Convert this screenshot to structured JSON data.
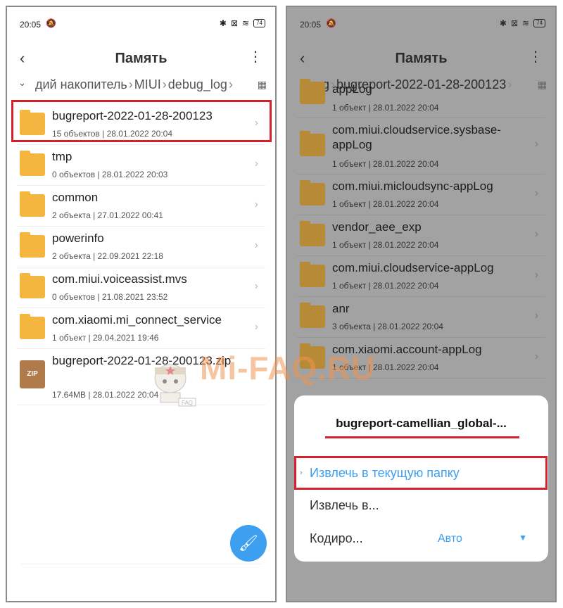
{
  "status": {
    "time": "20:05",
    "battery": "74"
  },
  "left": {
    "title": "Память",
    "breadcrumb": [
      "дий накопитель",
      "MIUI",
      "debug_log"
    ],
    "items": [
      {
        "name": "bugreport-2022-01-28-200123",
        "meta": "15 объектов | 28.01.2022 20:04",
        "type": "folder"
      },
      {
        "name": "tmp",
        "meta": "0 объектов | 28.01.2022 20:03",
        "type": "folder"
      },
      {
        "name": "common",
        "meta": "2 объекта | 27.01.2022 00:41",
        "type": "folder"
      },
      {
        "name": "powerinfo",
        "meta": "2 объекта | 22.09.2021 22:18",
        "type": "folder"
      },
      {
        "name": "com.miui.voiceassist.mvs",
        "meta": "0 объектов | 21.08.2021 23:52",
        "type": "folder"
      },
      {
        "name": "com.xiaomi.mi_connect_service",
        "meta": "1 объект | 29.04.2021 19:46",
        "type": "folder"
      },
      {
        "name": "bugreport-2022-01-28-200123.zip",
        "meta": "17.64MB | 28.01.2022 20:04",
        "type": "zip",
        "icon_text": "ZIP"
      }
    ]
  },
  "right": {
    "title": "Память",
    "breadcrumb": [
      "og",
      "bugreport-2022-01-28-200123"
    ],
    "items": [
      {
        "name": "appLog",
        "meta": "1 объект | 28.01.2022 20:04"
      },
      {
        "name": "com.miui.cloudservice.sysbase-appLog",
        "meta": "1 объект | 28.01.2022 20:04"
      },
      {
        "name": "com.miui.micloudsync-appLog",
        "meta": "1 объект | 28.01.2022 20:04"
      },
      {
        "name": "vendor_aee_exp",
        "meta": "1 объект | 28.01.2022 20:04"
      },
      {
        "name": "com.miui.cloudservice-appLog",
        "meta": "1 объект | 28.01.2022 20:04"
      },
      {
        "name": "anr",
        "meta": "3 объекта | 28.01.2022 20:04"
      },
      {
        "name": "com.xiaomi.account-appLog",
        "meta": "1 объект | 28.01.2022 20:04"
      }
    ],
    "sheet": {
      "title": "bugreport-camellian_global-...",
      "extract_here": "Извлечь в текущую папку",
      "extract_to": "Извлечь в...",
      "encoding_label": "Кодиро...",
      "encoding_value": "Авто"
    }
  },
  "watermark": {
    "text": "Mi-FAQ.RU",
    "badge": "FAQ"
  },
  "colors": {
    "accent": "#3d9ff0",
    "highlight": "#d3212d",
    "folder": "#f4b63f"
  }
}
